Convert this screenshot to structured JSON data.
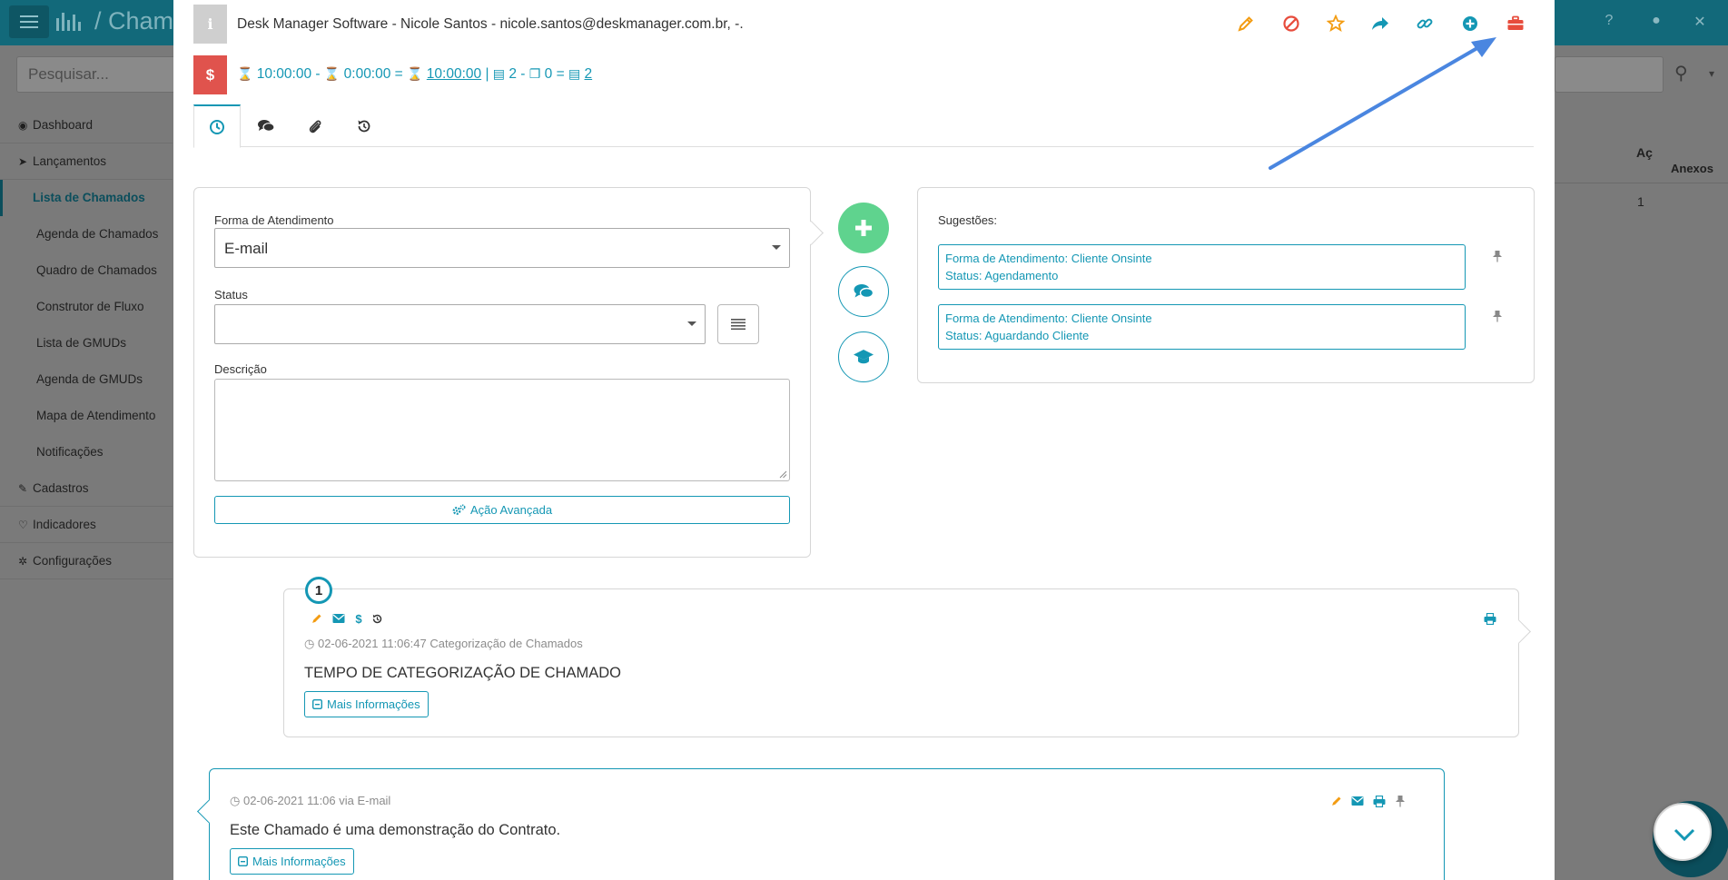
{
  "background": {
    "breadcrumb": "Chama",
    "search_placeholder": "Pesquisar...",
    "sidebar": [
      {
        "label": "Dashboard",
        "icon": "dashboard-icon",
        "glyph": "◉",
        "sub": false,
        "active": false
      },
      {
        "label": "Lançamentos",
        "icon": "paper-plane-icon",
        "glyph": "➤",
        "sub": false,
        "active": false
      },
      {
        "label": "Lista de Chamados",
        "icon": "",
        "glyph": "",
        "sub": true,
        "active": true
      },
      {
        "label": "Agenda de Chamados",
        "icon": "",
        "glyph": "",
        "sub": true,
        "active": false
      },
      {
        "label": "Quadro de Chamados",
        "icon": "",
        "glyph": "",
        "sub": true,
        "active": false
      },
      {
        "label": "Construtor de Fluxo",
        "icon": "",
        "glyph": "",
        "sub": true,
        "active": false
      },
      {
        "label": "Lista de GMUDs",
        "icon": "",
        "glyph": "",
        "sub": true,
        "active": false
      },
      {
        "label": "Agenda de GMUDs",
        "icon": "",
        "glyph": "",
        "sub": true,
        "active": false
      },
      {
        "label": "Mapa de Atendimento",
        "icon": "",
        "glyph": "",
        "sub": true,
        "active": false
      },
      {
        "label": "Notificações",
        "icon": "",
        "glyph": "",
        "sub": true,
        "active": false
      },
      {
        "label": "Cadastros",
        "icon": "edit-icon",
        "glyph": "✎",
        "sub": false,
        "active": false
      },
      {
        "label": "Indicadores",
        "icon": "heart-icon",
        "glyph": "♡",
        "sub": false,
        "active": false
      },
      {
        "label": "Configurações",
        "icon": "cog-icon",
        "glyph": "✲",
        "sub": false,
        "active": false
      }
    ],
    "table_header_1": "Aç",
    "table_header_2": "Anexos",
    "table_cell": "1"
  },
  "header": {
    "title": "Desk Manager Software - Nicole Santos - nicole.santos@deskmanager.com.br, -.",
    "info_glyph": "i",
    "money_glyph": "$",
    "time": {
      "t1": "10:00:00",
      "op1": "-",
      "t2": "0:00:00",
      "op2": "=",
      "t3": "10:00:00",
      "sep": "|",
      "d1": "2",
      "op3": "-",
      "d2": "0",
      "op4": "=",
      "d3": "2"
    }
  },
  "toolbar": [
    {
      "icon": "pencil-icon",
      "color": "#f39c12"
    },
    {
      "icon": "ban-icon",
      "color": "#e74c3c"
    },
    {
      "icon": "star-icon",
      "color": "#f39c12"
    },
    {
      "icon": "share-icon",
      "color": "#1497b4"
    },
    {
      "icon": "link-icon",
      "color": "#1497b4"
    },
    {
      "icon": "plus-circle-icon",
      "color": "#1497b4"
    },
    {
      "icon": "briefcase-icon",
      "color": "#e74c3c"
    }
  ],
  "tabs": [
    {
      "icon": "clock-icon",
      "active": true
    },
    {
      "icon": "comments-icon",
      "active": false
    },
    {
      "icon": "paperclip-icon",
      "active": false
    },
    {
      "icon": "history-icon",
      "active": false
    }
  ],
  "form": {
    "forma_label": "Forma de Atendimento",
    "forma_value": "E-mail",
    "status_label": "Status",
    "status_value": "",
    "descricao_label": "Descrição",
    "advanced_button": "Ação Avançada"
  },
  "suggestions": {
    "title": "Sugestões:",
    "items": [
      {
        "line1": "Forma de Atendimento: Cliente Onsinte",
        "line2": "Status: Agendamento"
      },
      {
        "line1": "Forma de Atendimento: Cliente Onsinte",
        "line2": "Status: Aguardando Cliente"
      }
    ]
  },
  "entries": [
    {
      "number": "1",
      "meta": "02-06-2021 11:06:47 Categorização de Chamados",
      "text": "TEMPO DE CATEGORIZAÇÃO DE CHAMADO",
      "more": "Mais Informações"
    },
    {
      "meta": "02-06-2021 11:06 via E-mail",
      "text": "Este Chamado é uma demonstração do Contrato.",
      "more": "Mais Informações"
    }
  ],
  "colors": {
    "accent": "#1497b4",
    "danger": "#e0534d",
    "warning": "#f39c12",
    "success": "#5fd38e",
    "annotation_arrow": "#4a86e0"
  }
}
